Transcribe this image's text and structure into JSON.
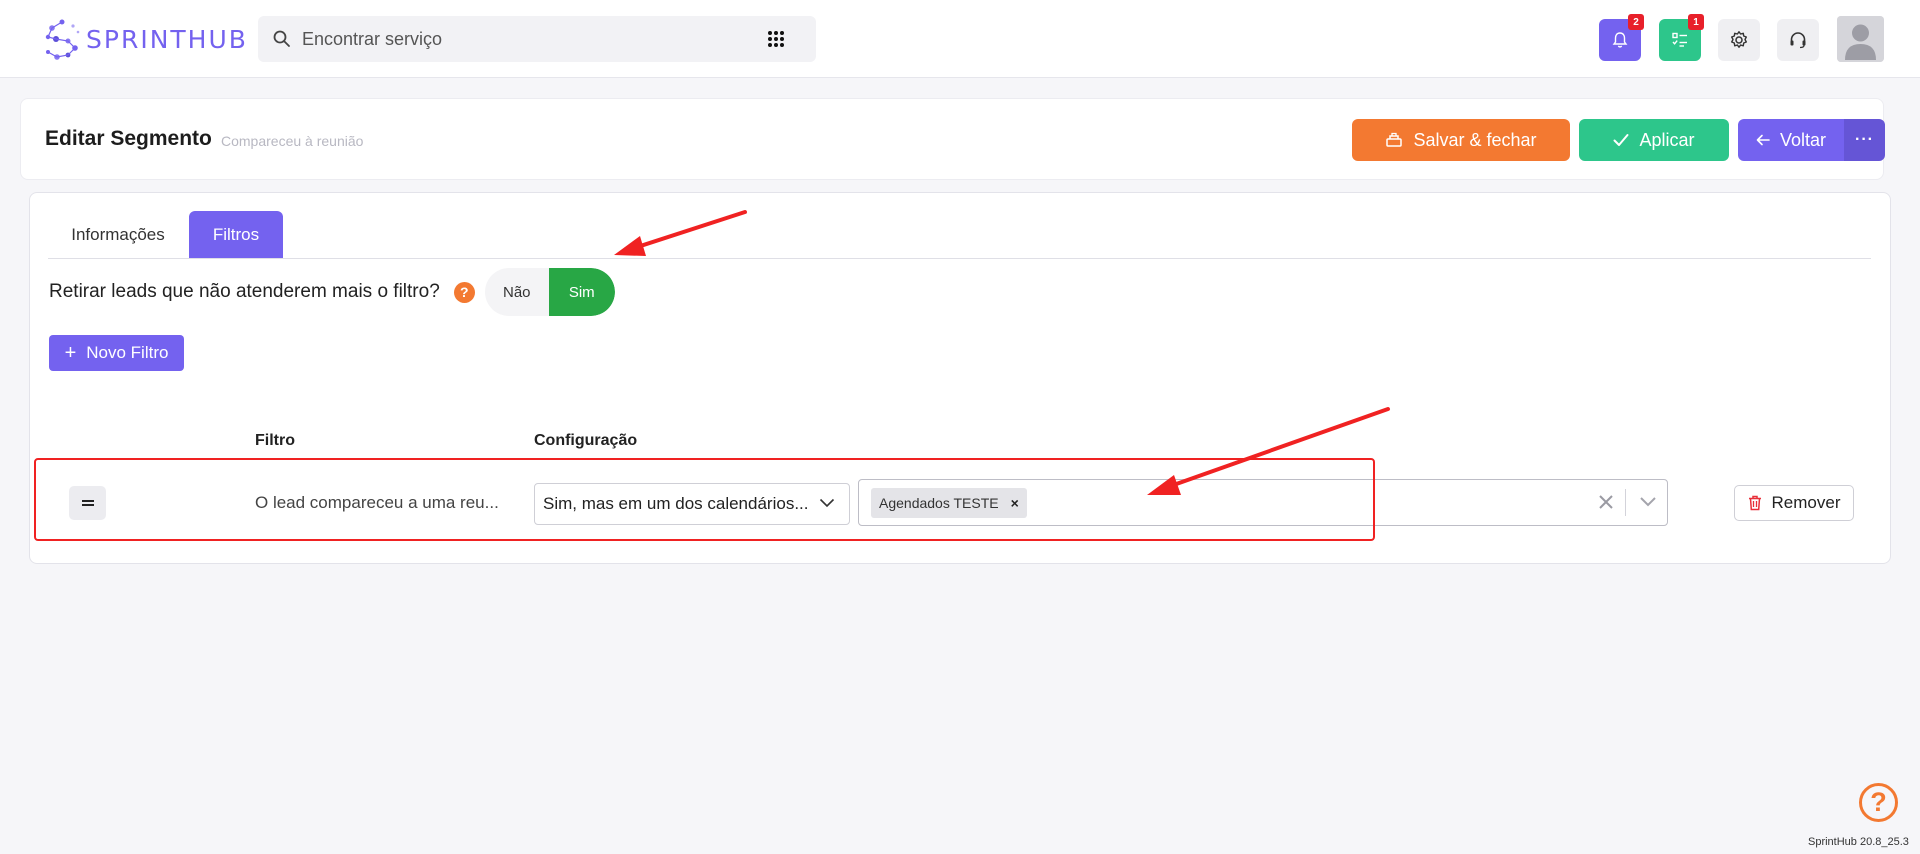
{
  "brand": {
    "logo_text": "SPRINTHUB",
    "accent": "#7462ef",
    "orange": "#f37931",
    "green": "#2dc68b"
  },
  "topbar": {
    "search_placeholder": "Encontrar serviço",
    "notifications_count": "2",
    "tasks_count": "1",
    "icons": [
      "search-icon",
      "apps-grid-icon",
      "bell-icon",
      "tasks-icon",
      "gear-icon",
      "headset-icon",
      "avatar"
    ]
  },
  "header": {
    "title": "Editar Segmento",
    "subtitle": "Compareceu à reunião",
    "save_close_label": "Salvar & fechar",
    "apply_label": "Aplicar",
    "back_label": "Voltar",
    "more_label": "···"
  },
  "tabs": [
    {
      "label": "Informações",
      "active": false
    },
    {
      "label": "Filtros",
      "active": true
    }
  ],
  "filters_tab": {
    "remove_leads_question": "Retirar leads que não atenderem mais o filtro?",
    "help_mark": "?",
    "toggle_no": "Não",
    "toggle_yes": "Sim",
    "toggle_selected": "Sim",
    "new_filter_label": "Novo Filtro",
    "columns": {
      "filtro": "Filtro",
      "configuracao": "Configuração"
    },
    "rows": [
      {
        "handle": "=",
        "filter_name": "O lead compareceu a uma reu...",
        "config_value": "Sim, mas em um dos calendários...",
        "selected_tags": [
          "Agendados TESTE"
        ],
        "tag_remove": "×",
        "remove_label": "Remover"
      }
    ]
  },
  "footer": {
    "help_mark": "?",
    "version": "SprintHub 20.8_25.3"
  }
}
